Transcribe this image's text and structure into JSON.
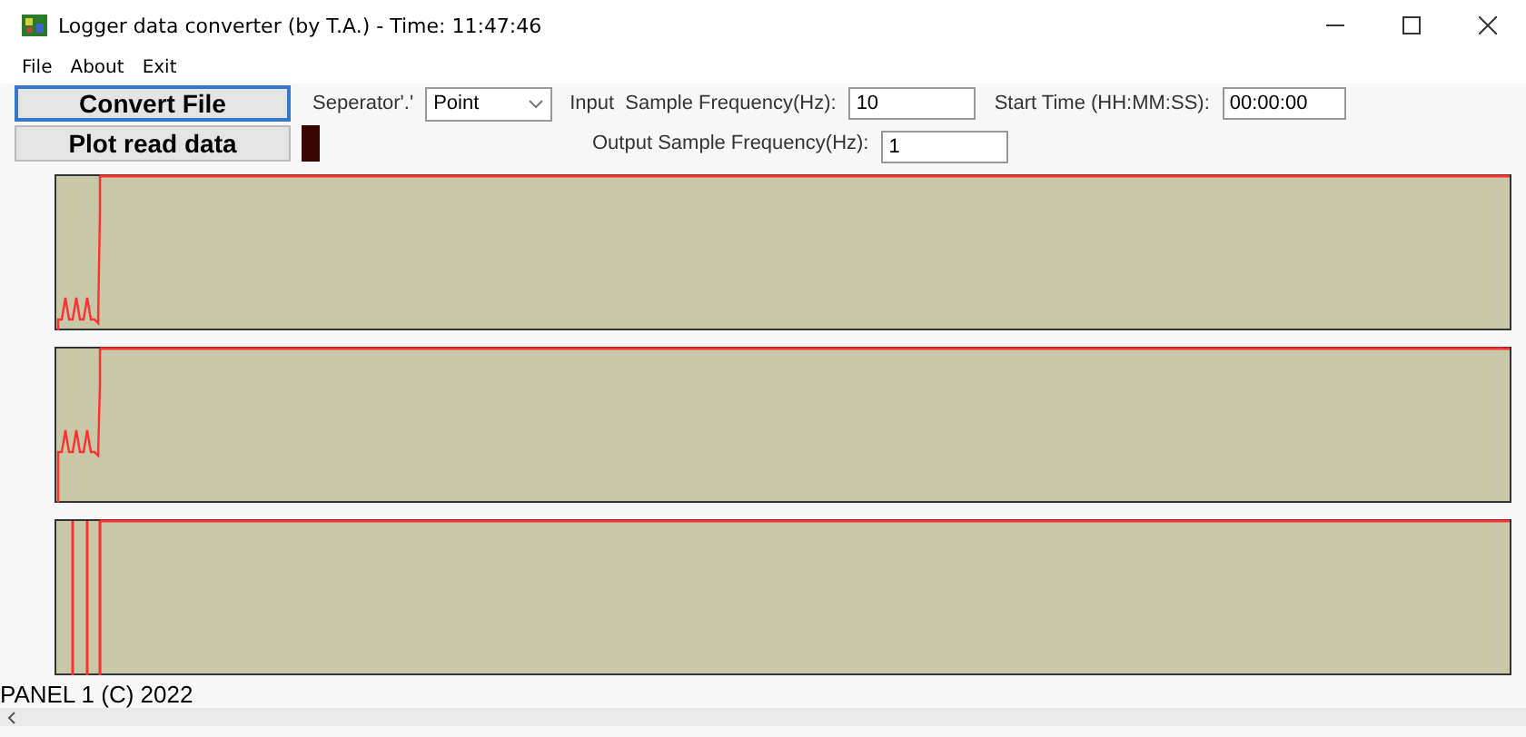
{
  "window": {
    "title": "Logger data converter (by T.A.) - Time: 11:47:46"
  },
  "menu": [
    "File",
    "About",
    "Exit"
  ],
  "buttons": {
    "convert": "Convert File",
    "plot": "Plot read data"
  },
  "separator": {
    "label": "Seperator'.'",
    "value": "Point"
  },
  "input_frequency": {
    "label": "Input  Sample Frequency(Hz):",
    "value": "10"
  },
  "output_frequency": {
    "label": "Output Sample Frequency(Hz):",
    "value": "1"
  },
  "start_time": {
    "label": "Start Time (HH:MM:SS):",
    "value": "00:00:00"
  },
  "plots": [
    {
      "kind": "spikes"
    },
    {
      "kind": "spikes"
    },
    {
      "kind": "lines"
    }
  ],
  "status_bar": "PANEL 1   (C) 2022"
}
